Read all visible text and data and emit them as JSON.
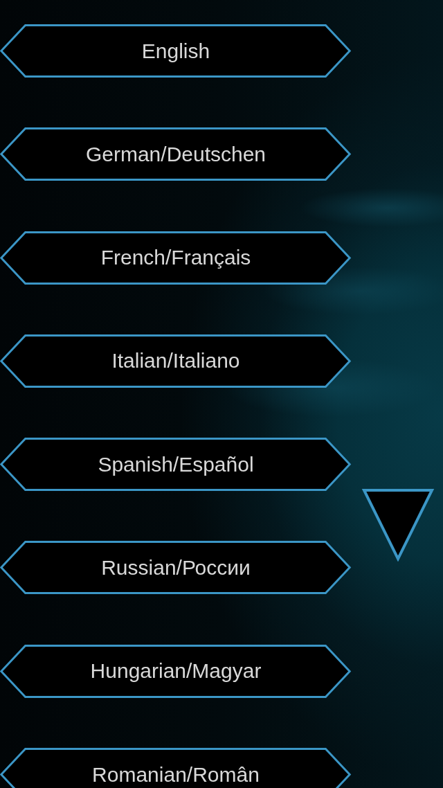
{
  "languages": [
    "English",
    "German/Deutschen",
    "French/Français",
    "Italian/Italiano",
    "Spanish/Español",
    "Russian/России",
    "Hungarian/Magyar",
    "Romanian/Român"
  ]
}
